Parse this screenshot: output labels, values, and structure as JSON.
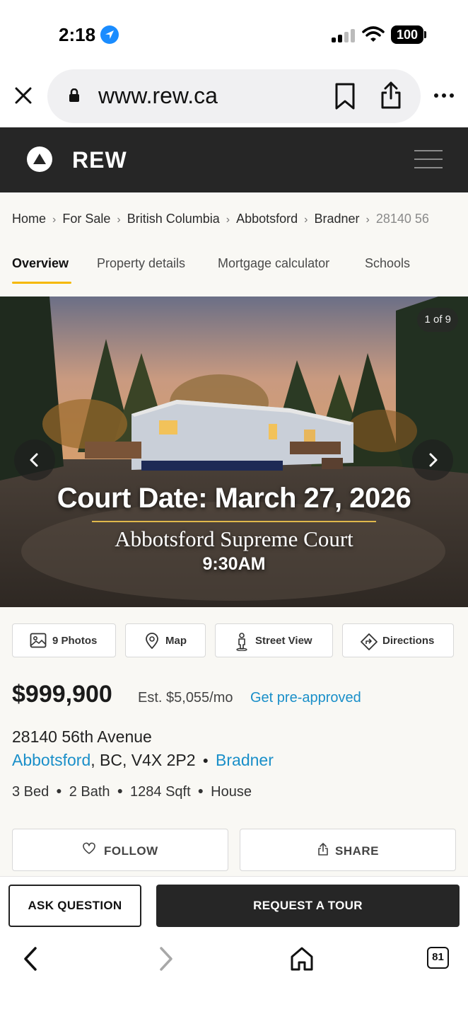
{
  "status_bar": {
    "time": "2:18",
    "battery": "100"
  },
  "browser": {
    "url": "www.rew.ca",
    "tab_count": "81",
    "icons": [
      "close-icon",
      "lock-icon",
      "bookmark-icon",
      "share-icon",
      "more-icon",
      "back-icon",
      "forward-icon",
      "home-icon",
      "tabs-icon"
    ]
  },
  "header": {
    "logo_text": "REW"
  },
  "breadcrumb": {
    "items": [
      "Home",
      "For Sale",
      "British Columbia",
      "Abbotsford",
      "Bradner"
    ],
    "current": "28140 56"
  },
  "tabs": [
    {
      "label": "Overview",
      "active": true
    },
    {
      "label": "Property details",
      "active": false
    },
    {
      "label": "Mortgage calculator",
      "active": false
    },
    {
      "label": "Schools",
      "active": false
    }
  ],
  "photo": {
    "counter": "1 of 9",
    "overlay_title": "Court Date: March 27, 2026",
    "overlay_court": "Abbotsford Supreme Court",
    "overlay_time": "9:30AM"
  },
  "media_buttons": {
    "photos": "9 Photos",
    "map": "Map",
    "street_view": "Street View",
    "directions": "Directions"
  },
  "listing": {
    "price": "$999,900",
    "est_payment": "Est. $5,055/mo",
    "preapproved_link": "Get pre-approved",
    "address": "28140 56th Avenue",
    "city": "Abbotsford",
    "province_postal": ", BC, V4X 2P2",
    "neighbourhood": "Bradner",
    "beds": "3 Bed",
    "baths": "2 Bath",
    "sqft": "1284 Sqft",
    "type": "House"
  },
  "actions": {
    "follow": "FOLLOW",
    "share": "SHARE"
  },
  "cta": {
    "ask": "ASK QUESTION",
    "tour": "REQUEST A TOUR"
  },
  "colors": {
    "header_bg": "#262626",
    "accent_yellow": "#f5b800",
    "link_blue": "#1a8fc9",
    "page_bg": "#f9f8f4"
  }
}
